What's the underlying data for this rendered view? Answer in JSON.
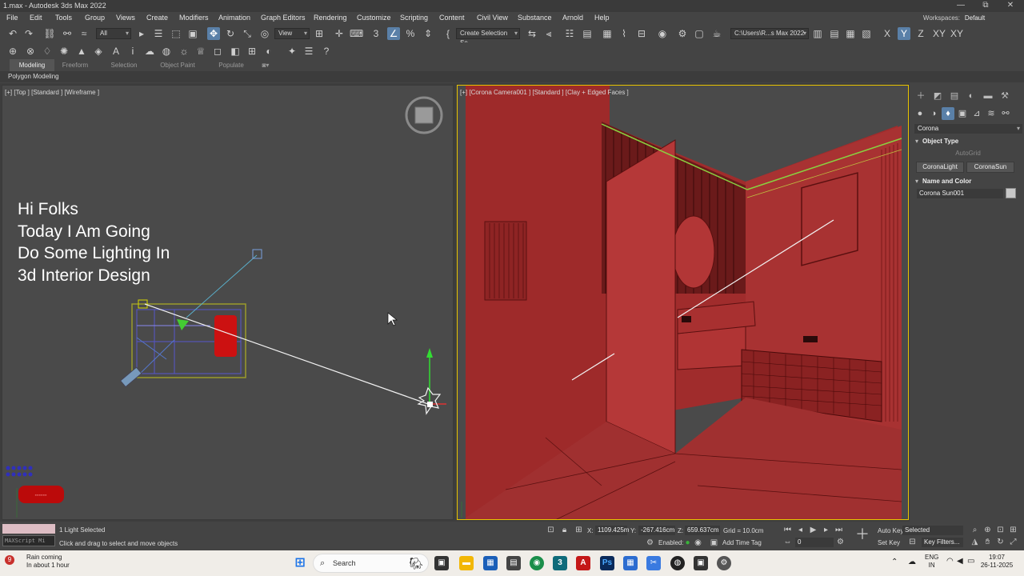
{
  "window": {
    "title": "1.max - Autodesk 3ds Max 2022",
    "controls": [
      "—",
      "⧉",
      "✕"
    ]
  },
  "menu": [
    "File",
    "Edit",
    "Tools",
    "Group",
    "Views",
    "Create",
    "Modifiers",
    "Animation",
    "Graph Editors",
    "Rendering",
    "Customize",
    "Scripting",
    "Content",
    "Civil View",
    "Substance",
    "Arnold",
    "Help"
  ],
  "workspaces": {
    "label": "Workspaces:",
    "value": "Default"
  },
  "toolbar": {
    "filter_all": "All",
    "ref_coord": "View",
    "named_selection": "Create Selection Se",
    "project_path": "C:\\Users\\R...s Max 2022",
    "axis_labels": [
      "X",
      "Y",
      "Z",
      "XY",
      "XY"
    ]
  },
  "ribbon": {
    "tabs": [
      "Modeling",
      "Freeform",
      "Selection",
      "Object Paint",
      "Populate"
    ],
    "active_tab": "Modeling",
    "sub_label": "Polygon Modeling"
  },
  "viewports": {
    "left_label": "[+] [Top ] [Standard ] [Wireframe ]",
    "right_label": "[+] [Corona Camera001 ] [Standard ] [Clay + Edged Faces ]",
    "overlay_lines": [
      "Hi Folks",
      "Today I Am Going",
      "Do Some Lighting In",
      "3d Interior Design"
    ]
  },
  "command_panel": {
    "renderer_dropdown": "Corona",
    "object_type_title": "Object Type",
    "autogrid": "AutoGrid",
    "buttons": [
      "CoronaLight",
      "CoronaSun"
    ],
    "name_color_title": "Name and Color",
    "object_name": "Corona Sun001"
  },
  "status": {
    "maxscript": "MAXScript Mi",
    "selection_text": "1 Light Selected",
    "prompt_text": "Click and drag to select and move objects",
    "x_label": "X:",
    "x_value": "1109.425m",
    "y_label": "Y:",
    "y_value": "-267.416cm",
    "z_label": "Z:",
    "z_value": "659.637cm",
    "grid_text": "Grid = 10.0cm",
    "enabled_label": "Enabled:",
    "add_time_tag": "Add Time Tag",
    "frame_value": "0",
    "auto_key": "Auto Key",
    "set_key": "Set Key",
    "selected_dd": "Selected",
    "key_filters": "Key Filters..."
  },
  "taskbar": {
    "weather_title": "Rain coming",
    "weather_sub": "In about 1 hour",
    "weather_badge": "9",
    "search_text": "Search",
    "lang_top": "ENG",
    "lang_bottom": "IN",
    "time": "19:07",
    "date": "26-11-2025"
  },
  "colors": {
    "active_button": "#5a80a8",
    "viewport_border_active": "#e8c400",
    "wall_red": "#9e2a2a",
    "overlay_text": "#ffffff"
  }
}
